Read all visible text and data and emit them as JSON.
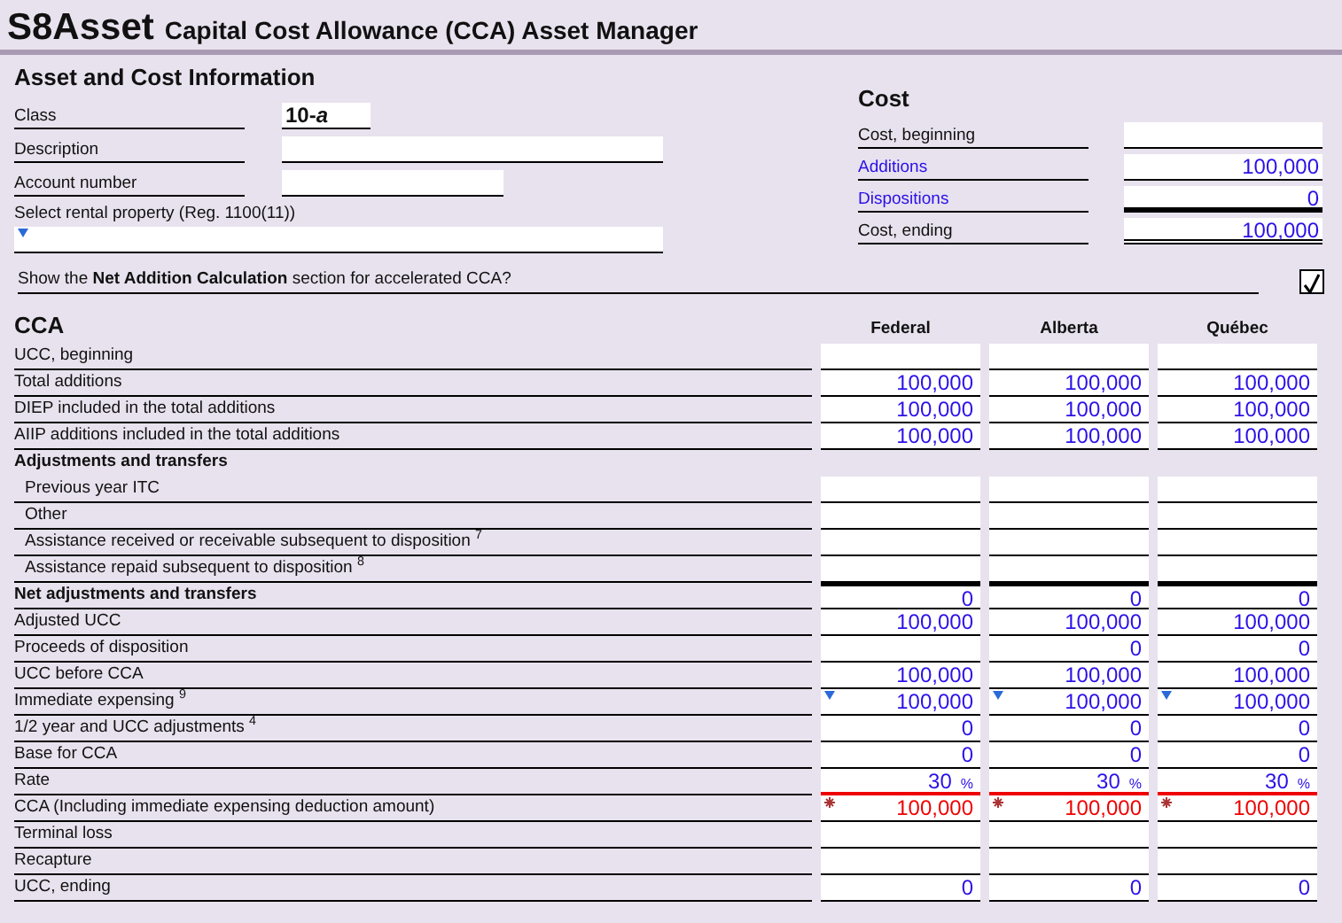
{
  "header": {
    "code": "S8Asset",
    "title": "Capital Cost Allowance (CCA) Asset Manager"
  },
  "asset_info": {
    "heading": "Asset and Cost Information",
    "fields": [
      {
        "label": "Class",
        "value": "10-*a*",
        "kind": "text"
      },
      {
        "label": "Description",
        "kind": "text"
      },
      {
        "label": "Account number",
        "kind": "text"
      },
      {
        "label": "Select rental property (Reg. 1100(11))",
        "kind": "dropdown"
      }
    ]
  },
  "cost": {
    "heading": "Cost",
    "rows": [
      {
        "kind": "entry",
        "label": "Cost, beginning",
        "link": false
      },
      {
        "kind": "entry",
        "label": "Additions",
        "value": "100,000",
        "link": true
      },
      {
        "kind": "subtotal",
        "label": "Dispositions",
        "value": "0",
        "link": true
      },
      {
        "kind": "total",
        "label": "Cost, ending",
        "value": "100,000",
        "link": false
      }
    ]
  },
  "net_addition_toggle": {
    "label": "Show the **Net Addition Calculation** section for accelerated CCA?",
    "checked": true
  },
  "cca": {
    "heading": "CCA",
    "columns": [
      "Federal",
      "Alberta",
      "Québec"
    ],
    "rows": [
      {
        "kind": "blank",
        "label": "UCC, beginning"
      },
      {
        "kind": "row",
        "label": "Total additions",
        "values": [
          "100,000",
          "100,000",
          "100,000"
        ]
      },
      {
        "kind": "row",
        "label": "DIEP included in the total additions",
        "values": [
          "100,000",
          "100,000",
          "100,000"
        ]
      },
      {
        "kind": "row",
        "label": "AIIP additions included in the total additions",
        "values": [
          "100,000",
          "100,000",
          "100,000"
        ]
      },
      {
        "kind": "heading",
        "label": "Adjustments and transfers"
      },
      {
        "kind": "sub",
        "label": "Previous year ITC"
      },
      {
        "kind": "sub",
        "label": "Other"
      },
      {
        "kind": "sub",
        "label": "Assistance received or receivable subsequent to disposition $^{7}$"
      },
      {
        "kind": "sub",
        "label": "Assistance repaid subsequent to disposition $^{8}$"
      },
      {
        "kind": "total",
        "label": "Net adjustments and transfers",
        "values": [
          "0",
          "0",
          "0"
        ]
      },
      {
        "kind": "row",
        "label": "Adjusted UCC",
        "values": [
          "100,000",
          "100,000",
          "100,000"
        ]
      },
      {
        "kind": "provincial",
        "label": "Proceeds of disposition",
        "values": [
          "0",
          "0"
        ]
      },
      {
        "kind": "row",
        "label": "UCC before CCA",
        "values": [
          "100,000",
          "100,000",
          "100,000"
        ]
      },
      {
        "kind": "dropdown",
        "label": "Immediate expensing $^{9}$",
        "values": [
          "100,000",
          "100,000",
          "100,000"
        ]
      },
      {
        "kind": "row",
        "label": "1/2 year and UCC adjustments $^{4}$",
        "values": [
          "0",
          "0",
          "0"
        ]
      },
      {
        "kind": "row",
        "label": "Base for CCA",
        "values": [
          "0",
          "0",
          "0"
        ]
      },
      {
        "kind": "rate",
        "label": "Rate",
        "values": [
          "30",
          "30",
          "30"
        ],
        "suffix": "%"
      },
      {
        "kind": "flagged",
        "label": "CCA (Including immediate expensing deduction amount)",
        "values": [
          "100,000",
          "100,000",
          "100,000"
        ]
      },
      {
        "kind": "blank",
        "label": "Terminal loss"
      },
      {
        "kind": "blank",
        "label": "Recapture"
      },
      {
        "kind": "row",
        "label": "UCC, ending",
        "values": [
          "0",
          "0",
          "0"
        ]
      }
    ]
  }
}
